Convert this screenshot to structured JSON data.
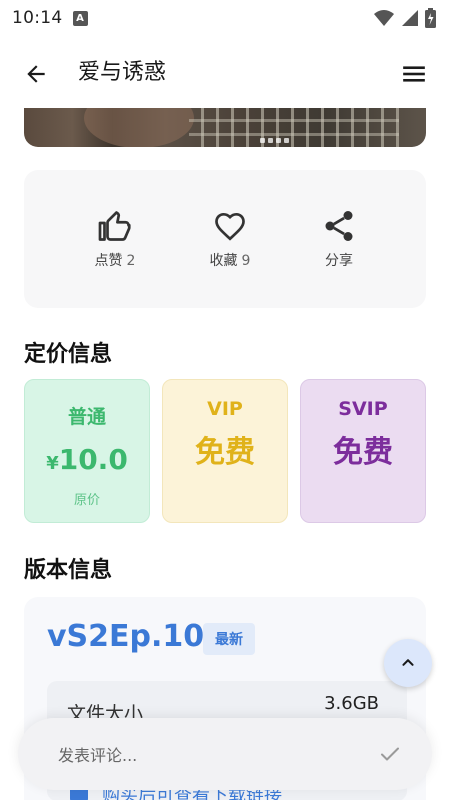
{
  "status_bar": {
    "time": "10:14",
    "notification_letter": "A"
  },
  "app_bar": {
    "title": "爱与诱惑"
  },
  "actions": {
    "like": {
      "label": "点赞",
      "count": "2"
    },
    "favorite": {
      "label": "收藏",
      "count": "9"
    },
    "share": {
      "label": "分享"
    }
  },
  "pricing": {
    "title": "定价信息",
    "normal": {
      "tier": "普通",
      "currency": "¥",
      "price": "10.0",
      "note": "原价"
    },
    "vip": {
      "tier": "VIP",
      "price": "免费"
    },
    "svip": {
      "tier": "SVIP",
      "price": "免费"
    }
  },
  "version": {
    "title": "版本信息",
    "name": "vS2Ep.10",
    "badge": "最新",
    "file_size_label": "文件大小",
    "file_size": "3.6GB",
    "buy_hint": "购买后可查看下载链接"
  },
  "comment": {
    "placeholder": "发表评论..."
  },
  "colors": {
    "accent": "#3b79d6",
    "normal_green": "#3cb86e",
    "vip_gold": "#e0b21a",
    "svip_purple": "#7c2d9c"
  }
}
